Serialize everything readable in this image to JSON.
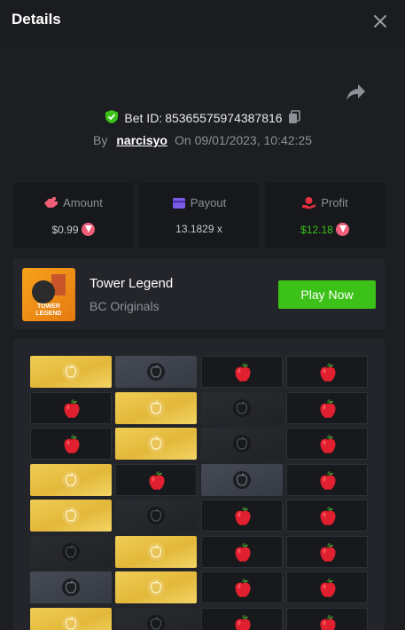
{
  "header": {
    "title": "Details"
  },
  "bet": {
    "label": "Bet ID:",
    "id": "85365575974387816"
  },
  "byline": {
    "by": "By",
    "user": "narcisyo",
    "on": "On",
    "date": "09/01/2023, 10:42:25"
  },
  "stats": [
    {
      "label": "Amount",
      "value": "$0.99"
    },
    {
      "label": "Payout",
      "value": "13.1829 x"
    },
    {
      "label": "Profit",
      "value": "$12.18"
    }
  ],
  "game": {
    "name": "Tower Legend",
    "provider": "BC Originals",
    "logo_text": "TOWER LEGEND",
    "play_label": "Play Now"
  },
  "colors": {
    "green": "#3bc117",
    "gold": "#e9c44a",
    "apple_red": "#e0202e",
    "coin": "#ef5f7a"
  },
  "board": {
    "legend": {
      "gold": "picked safe tile",
      "gray": "picked",
      "dim": "unrevealed safe tile",
      "red": "apple"
    },
    "rows": [
      [
        "gold",
        "gray",
        "red",
        "red"
      ],
      [
        "red",
        "gold",
        "dim",
        "red"
      ],
      [
        "red",
        "gold",
        "dim",
        "red"
      ],
      [
        "gold",
        "red",
        "gray",
        "red"
      ],
      [
        "gold",
        "dim",
        "red",
        "red"
      ],
      [
        "dim",
        "gold",
        "red",
        "red"
      ],
      [
        "gray",
        "gold",
        "red",
        "red"
      ],
      [
        "gold",
        "dim",
        "red",
        "red"
      ]
    ]
  }
}
